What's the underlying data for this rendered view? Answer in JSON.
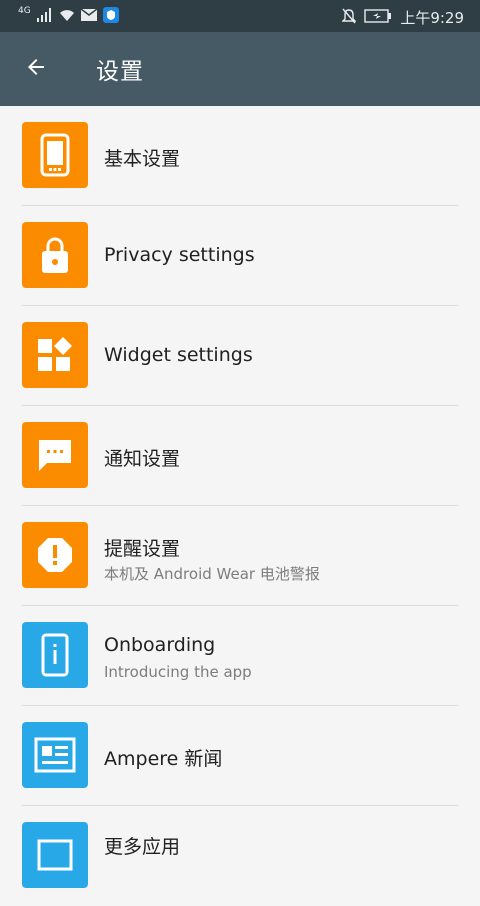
{
  "status_bar": {
    "network_type": "4G",
    "time": "上午9:29",
    "icons": [
      "signal-icon",
      "wifi-icon",
      "mail-icon",
      "shield-app-icon",
      "mute-bell-icon",
      "battery-icon"
    ]
  },
  "toolbar": {
    "title": "设置",
    "back_icon": "arrow-back-icon"
  },
  "colors": {
    "toolbar": "#455a64",
    "status_bar": "#2f3d45",
    "orange": "#fb8c00",
    "blue": "#29a8e8"
  },
  "items": [
    {
      "label": "基本设置",
      "subtitle": "",
      "icon": "phone-icon",
      "color": "orange"
    },
    {
      "label": "Privacy settings",
      "subtitle": "",
      "icon": "lock-icon",
      "color": "orange"
    },
    {
      "label": "Widget settings",
      "subtitle": "",
      "icon": "widgets-icon",
      "color": "orange"
    },
    {
      "label": "通知设置",
      "subtitle": "",
      "icon": "message-icon",
      "color": "orange"
    },
    {
      "label": "提醒设置",
      "subtitle": "本机及 Android Wear 电池警报",
      "icon": "alert-octagon-icon",
      "color": "orange"
    },
    {
      "label": "Onboarding",
      "subtitle": "Introducing the app",
      "icon": "info-phone-icon",
      "color": "blue"
    },
    {
      "label": "Ampere 新闻",
      "subtitle": "",
      "icon": "news-icon",
      "color": "blue"
    },
    {
      "label": "更多应用",
      "subtitle": "",
      "icon": "apps-icon",
      "color": "blue"
    }
  ]
}
